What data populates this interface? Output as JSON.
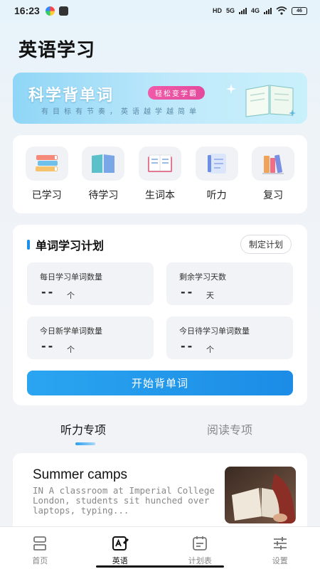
{
  "status_bar": {
    "time": "16:23",
    "network_labels": [
      "HD",
      "5G",
      "4G"
    ],
    "battery": "46"
  },
  "page": {
    "title": "英语学习"
  },
  "banner": {
    "title": "科学背单词",
    "badge": "轻松变学霸",
    "subtitle": "有目标有节奏，英语越学越简单"
  },
  "categories": [
    {
      "label": "已学习",
      "icon": "stacked-books-icon"
    },
    {
      "label": "待学习",
      "icon": "open-book-icon"
    },
    {
      "label": "生词本",
      "icon": "notebook-icon"
    },
    {
      "label": "听力",
      "icon": "document-icon"
    },
    {
      "label": "复习",
      "icon": "upright-books-icon"
    }
  ],
  "plan": {
    "title": "单词学习计划",
    "set_plan_label": "制定计划",
    "stats": [
      {
        "label": "每日学习单词数量",
        "value": "--",
        "unit": "个"
      },
      {
        "label": "剩余学习天数",
        "value": "--",
        "unit": "天"
      },
      {
        "label": "今日新学单词数量",
        "value": "--",
        "unit": "个"
      },
      {
        "label": "今日待学习单词数量",
        "value": "--",
        "unit": "个"
      }
    ],
    "start_label": "开始背单词"
  },
  "tabs": {
    "active": "听力专项",
    "inactive": "阅读专项"
  },
  "article": {
    "title": "Summer camps",
    "excerpt": "IN A classroom at Imperial College London, students sit hunched over laptops, typing..."
  },
  "bottom_nav": [
    {
      "label": "首页",
      "icon": "home-icon",
      "active": false
    },
    {
      "label": "英语",
      "icon": "english-edit-icon",
      "active": true
    },
    {
      "label": "计划表",
      "icon": "calendar-icon",
      "active": false
    },
    {
      "label": "设置",
      "icon": "sliders-icon",
      "active": false
    }
  ],
  "colors": {
    "accent": "#1e8fe8",
    "badge": "#e84e9f",
    "background": "#f1f3f7"
  }
}
